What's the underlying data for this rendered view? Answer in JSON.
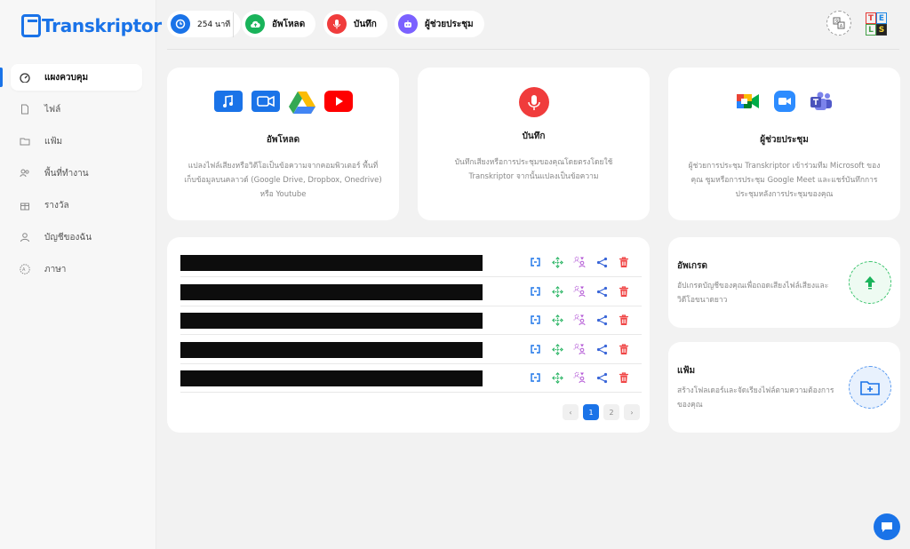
{
  "app": {
    "logo_text": "Transkriptor"
  },
  "sidebar": {
    "items": [
      {
        "label": "แผงควบคุม",
        "icon": "dashboard-icon",
        "active": true
      },
      {
        "label": "ไฟล์",
        "icon": "file-icon"
      },
      {
        "label": "แฟ้ม",
        "icon": "folder-icon"
      },
      {
        "label": "พื้นที่ทำงาน",
        "icon": "workspace-icon"
      },
      {
        "label": "รางวัล",
        "icon": "gift-icon"
      },
      {
        "label": "บัญชีของฉัน",
        "icon": "user-icon"
      },
      {
        "label": "ภาษา",
        "icon": "language-icon"
      }
    ]
  },
  "topbar": {
    "minutes_label": "254 นาที",
    "upload_label": "อัพโหลด",
    "record_label": "บันทึก",
    "assistant_label": "ผู้ช่วยประชุม",
    "tels_letters": [
      "T",
      "E",
      "L",
      "S"
    ]
  },
  "features": [
    {
      "title": "อัพโหลด",
      "desc": "แปลงไฟล์เสียงหรือวิดีโอเป็นข้อความจากคอมพิวเตอร์ พื้นที่เก็บข้อมูลบนคลาวด์ (Google Drive, Dropbox, Onedrive) หรือ Youtube"
    },
    {
      "title": "บันทึก",
      "desc": "บันทึกเสียงหรือการประชุมของคุณโดยตรงโดยใช้ Transkriptor จากนั้นแปลงเป็นข้อความ"
    },
    {
      "title": "ผู้ช่วยประชุม",
      "desc": "ผู้ช่วยการประชุม Transkriptor เข้าร่วมทีม Microsoft ของคุณ ซูมหรือการประชุม Google Meet และแชร์บันทึกการประชุมหลังการประชุมของคุณ"
    }
  ],
  "files": {
    "row_count": 5,
    "row_actions": [
      "translate-icon",
      "move-icon",
      "speaker-icon",
      "share-icon",
      "delete-icon"
    ]
  },
  "pagination": {
    "prev": "‹",
    "pages": [
      "1",
      "2"
    ],
    "current": "1",
    "next": "›"
  },
  "upgrade": {
    "title": "อัพเกรด",
    "desc": "อัปเกรดบัญชีของคุณเพื่อถอดเสียงไฟล์เสียงและวิดีโอขนาดยาว"
  },
  "folder": {
    "title": "แฟ้ม",
    "desc": "สร้างโฟลเดอร์และจัดเรียงไฟล์ตามความต้องการของคุณ"
  },
  "colors": {
    "brand": "#1a73e8",
    "upload_green": "#19b35a",
    "record_red": "#f03c3c",
    "assistant_purple": "#7b61ff",
    "delete_red": "#f04747",
    "move_green": "#28b463",
    "speaker_purple": "#b45ad6",
    "share_blue": "#3a66d8"
  }
}
